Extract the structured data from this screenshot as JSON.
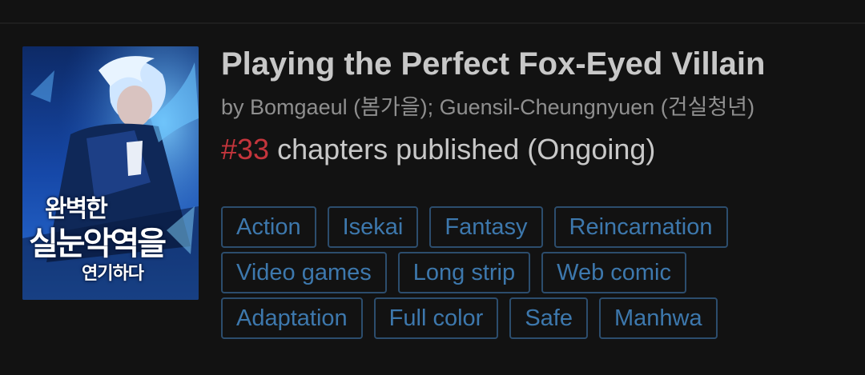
{
  "manga": {
    "title": "Playing the Perfect Fox-Eyed Villain",
    "authors": "by Bomgaeul (봄가을); Guensil-Cheungnyuen (건실청년)",
    "chapters_number": "#33",
    "chapters_text": " chapters published (Ongoing)",
    "cover": {
      "title_line1": "완벽한",
      "title_line2": "실눈악역을",
      "title_line3": "연기하다"
    }
  },
  "tags": [
    [
      "Action",
      "Isekai",
      "Fantasy",
      "Reincarnation"
    ],
    [
      "Video games",
      "Long strip",
      "Web comic"
    ],
    [
      "Adaptation",
      "Full color",
      "Safe",
      "Manhwa"
    ]
  ],
  "colors": {
    "background": "#121212",
    "title": "#c8c8c8",
    "authors": "#8f8f8f",
    "chapter_number": "#c4353c",
    "tag_border": "#2c4d6d",
    "tag_text": "#3d78ad"
  }
}
